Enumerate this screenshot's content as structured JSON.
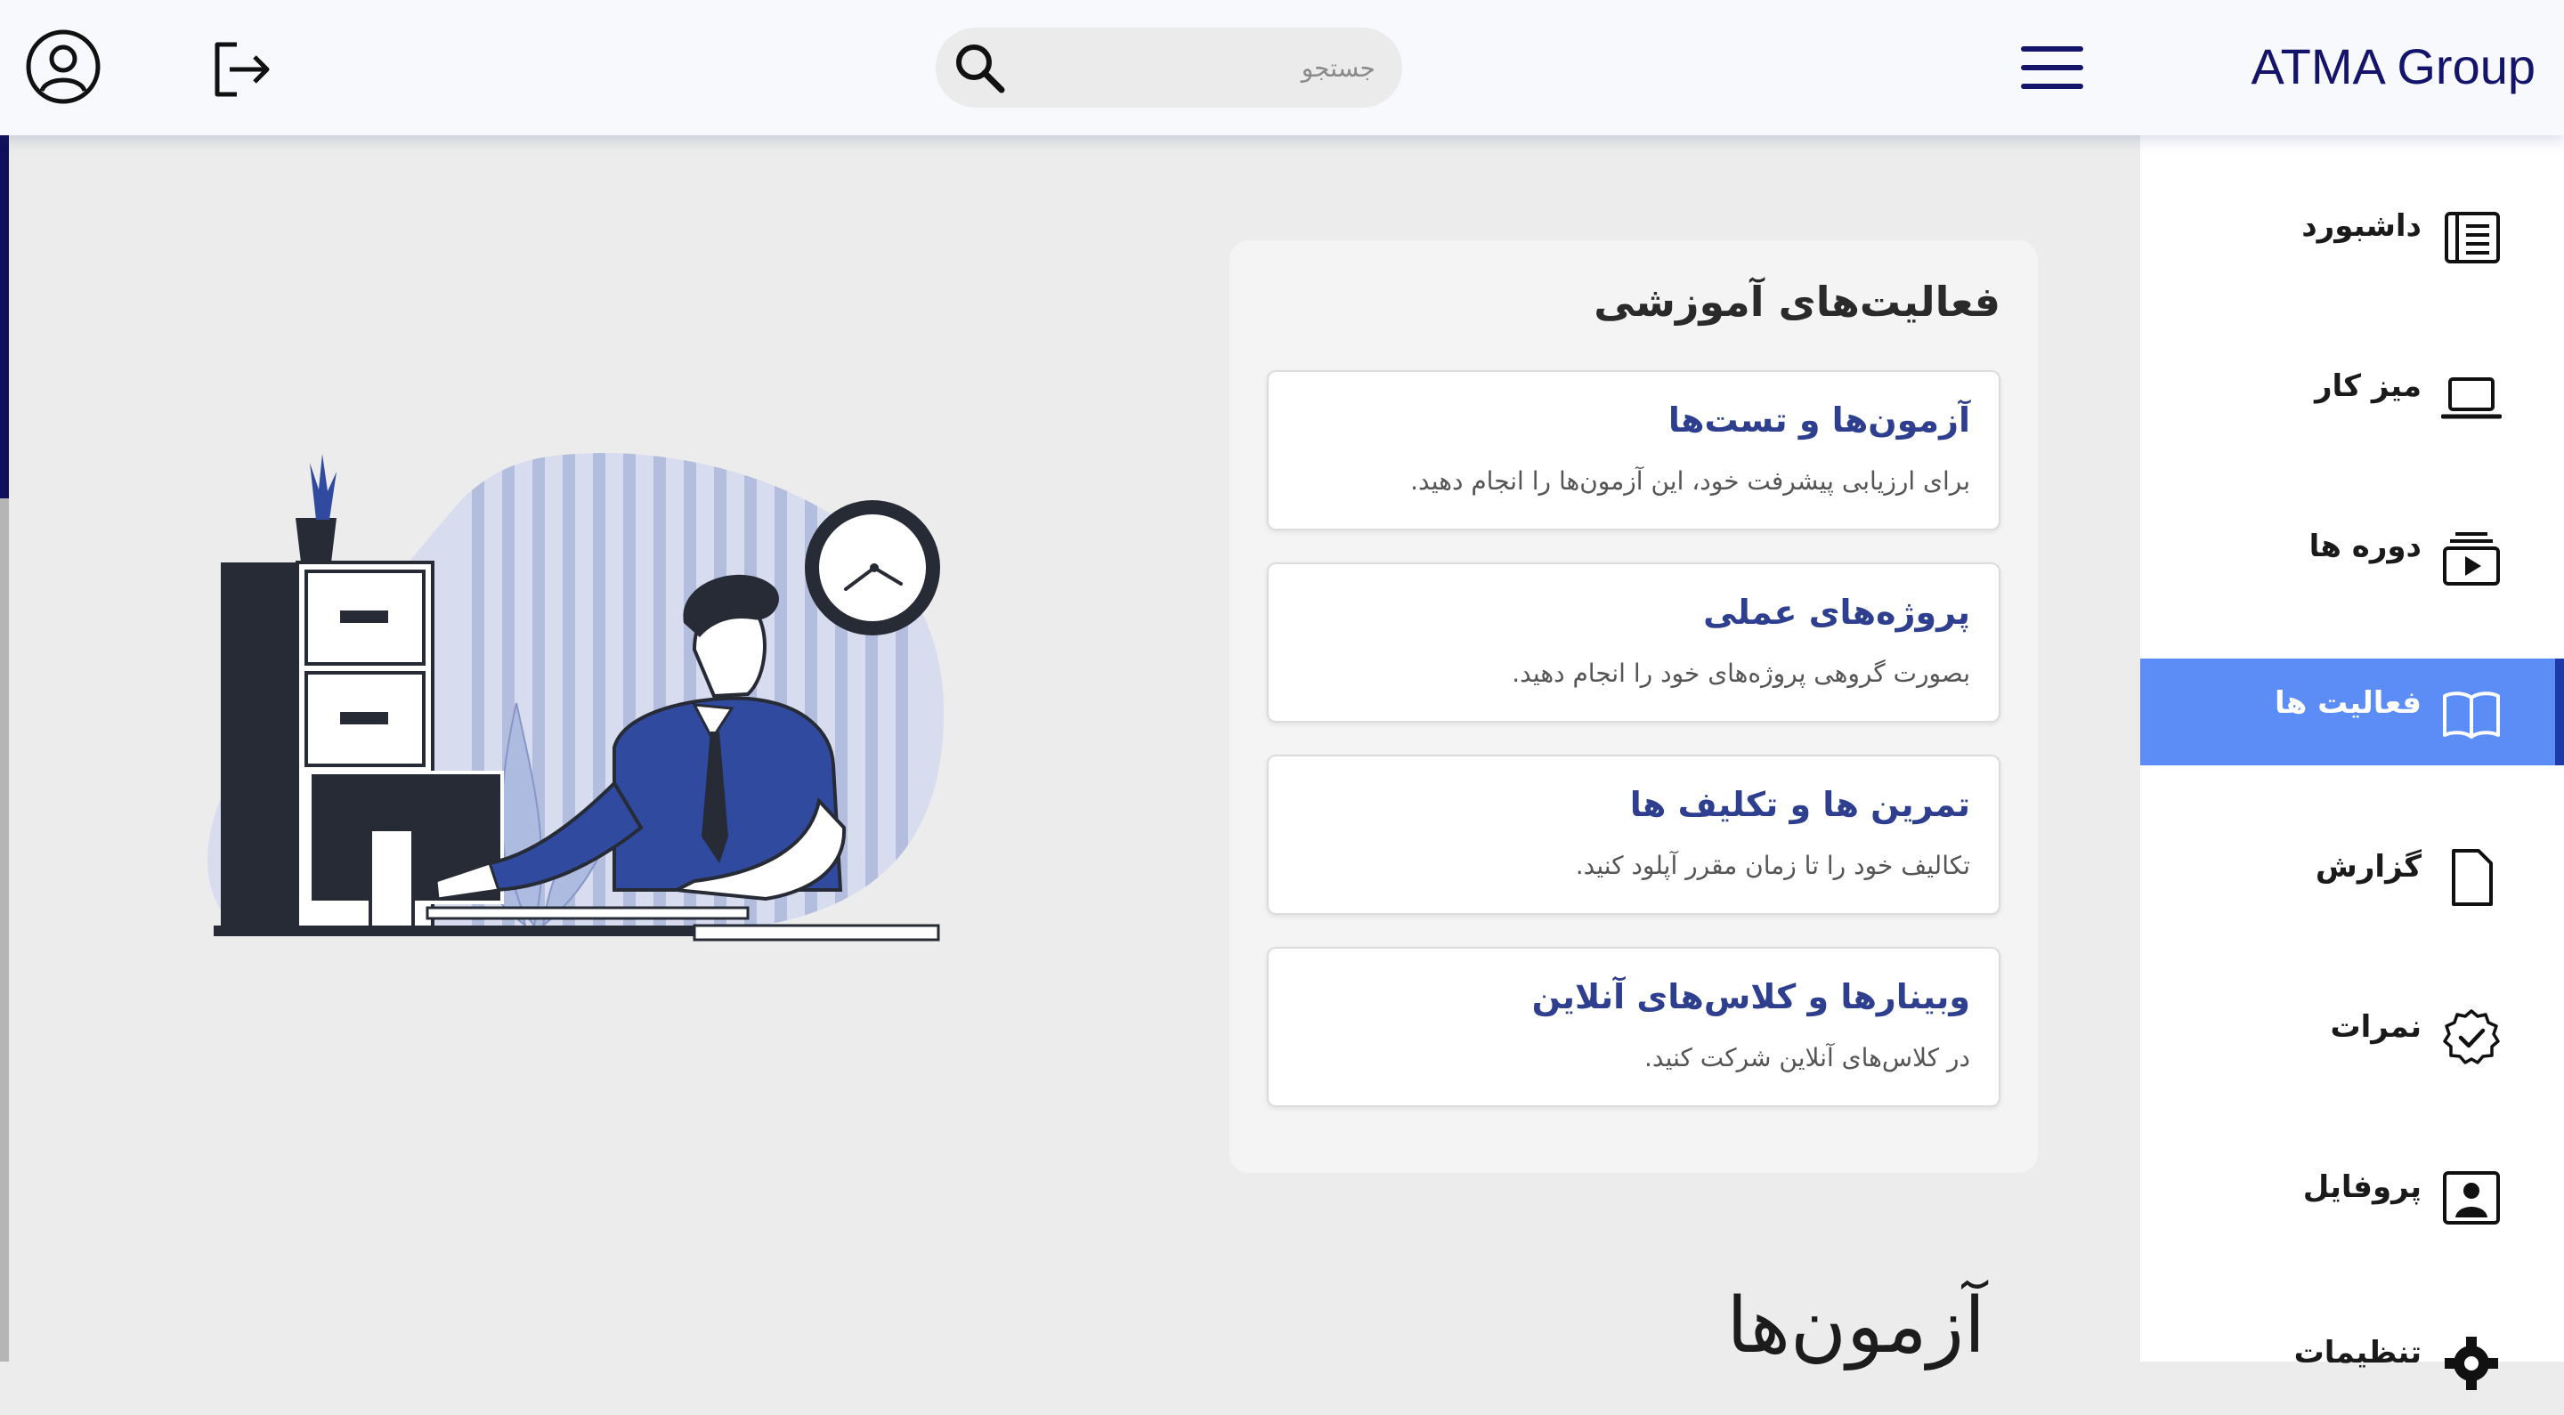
{
  "header": {
    "brand": "ATMA Group",
    "search": {
      "placeholder": "جستجو",
      "value": ""
    },
    "icons": {
      "menu": "hamburger-menu-icon",
      "search": "search-icon",
      "logout": "logout-icon",
      "account": "account-circle-icon"
    }
  },
  "sidebar": {
    "items": [
      {
        "label": "داشبورد",
        "icon": "newspaper-icon",
        "active": false
      },
      {
        "label": "میز کار",
        "icon": "laptop-icon",
        "active": false
      },
      {
        "label": "دوره ها",
        "icon": "video-library-icon",
        "active": false
      },
      {
        "label": "فعالیت ها",
        "icon": "open-book-icon",
        "active": true
      },
      {
        "label": "گزارش",
        "icon": "document-icon",
        "active": false
      },
      {
        "label": "نمرات",
        "icon": "check-badge-icon",
        "active": false
      },
      {
        "label": "پروفایل",
        "icon": "profile-card-icon",
        "active": false
      },
      {
        "label": "تنظیمات",
        "icon": "gear-icon",
        "active": false
      }
    ],
    "active_color": "#5c8df6"
  },
  "activities": {
    "title": "فعالیت‌های آموزشی",
    "items": [
      {
        "title": "آزمون‌ها و تست‌ها",
        "description": "برای ارزیابی پیشرفت خود، این آزمون‌ها را انجام دهید."
      },
      {
        "title": "پروژه‌های عملی",
        "description": "بصورت گروهی پروژه‌های خود را انجام دهید."
      },
      {
        "title": "تمرین ها و تکلیف ها",
        "description": "تکالیف خود را تا زمان مقرر آپلود کنید."
      },
      {
        "title": "وبینارها و کلاس‌های آنلاین",
        "description": "در کلاس‌های آنلاین شرکت کنید."
      }
    ]
  },
  "exams_section": {
    "title": "آزمون‌ها"
  },
  "colors": {
    "brand": "#14146b",
    "link_title": "#2e3f8f",
    "illustration_blue": "#2f4a9e"
  }
}
